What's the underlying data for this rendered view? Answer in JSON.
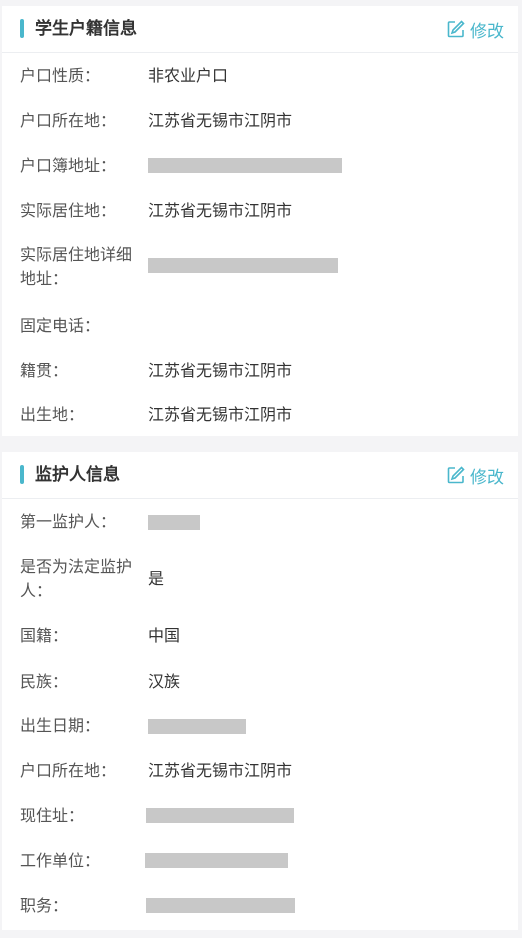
{
  "student_household": {
    "title": "学生户籍信息",
    "edit_label": "修改",
    "fields": [
      {
        "label": "户口性质：",
        "value": "非农业户口"
      },
      {
        "label": "户口所在地：",
        "value": "江苏省无锡市江阴市"
      },
      {
        "label": "户口簿地址：",
        "value": ""
      },
      {
        "label": "实际居住地：",
        "value": "江苏省无锡市江阴市"
      },
      {
        "label": "实际居住地详细地址：",
        "value": ""
      },
      {
        "label": "固定电话：",
        "value": ""
      },
      {
        "label": "籍贯：",
        "value": "江苏省无锡市江阴市"
      },
      {
        "label": "出生地：",
        "value": "江苏省无锡市江阴市"
      }
    ]
  },
  "guardian": {
    "title": "监护人信息",
    "edit_label": "修改",
    "fields": [
      {
        "label": "第一监护人：",
        "value": ""
      },
      {
        "label": "是否为法定监护人：",
        "value": "是"
      },
      {
        "label": "国籍：",
        "value": "中国"
      },
      {
        "label": "民族：",
        "value": "汉族"
      },
      {
        "label": "出生日期：",
        "value": ""
      },
      {
        "label": "户口所在地：",
        "value": "江苏省无锡市江阴市"
      },
      {
        "label": "现住址：",
        "value": ""
      },
      {
        "label": "工作单位：",
        "value": ""
      },
      {
        "label": "职务：",
        "value": ""
      }
    ]
  },
  "icons": {
    "edit": "edit-icon"
  },
  "colors": {
    "accent": "#4ab7cc",
    "redaction": "#c8c8c8"
  }
}
